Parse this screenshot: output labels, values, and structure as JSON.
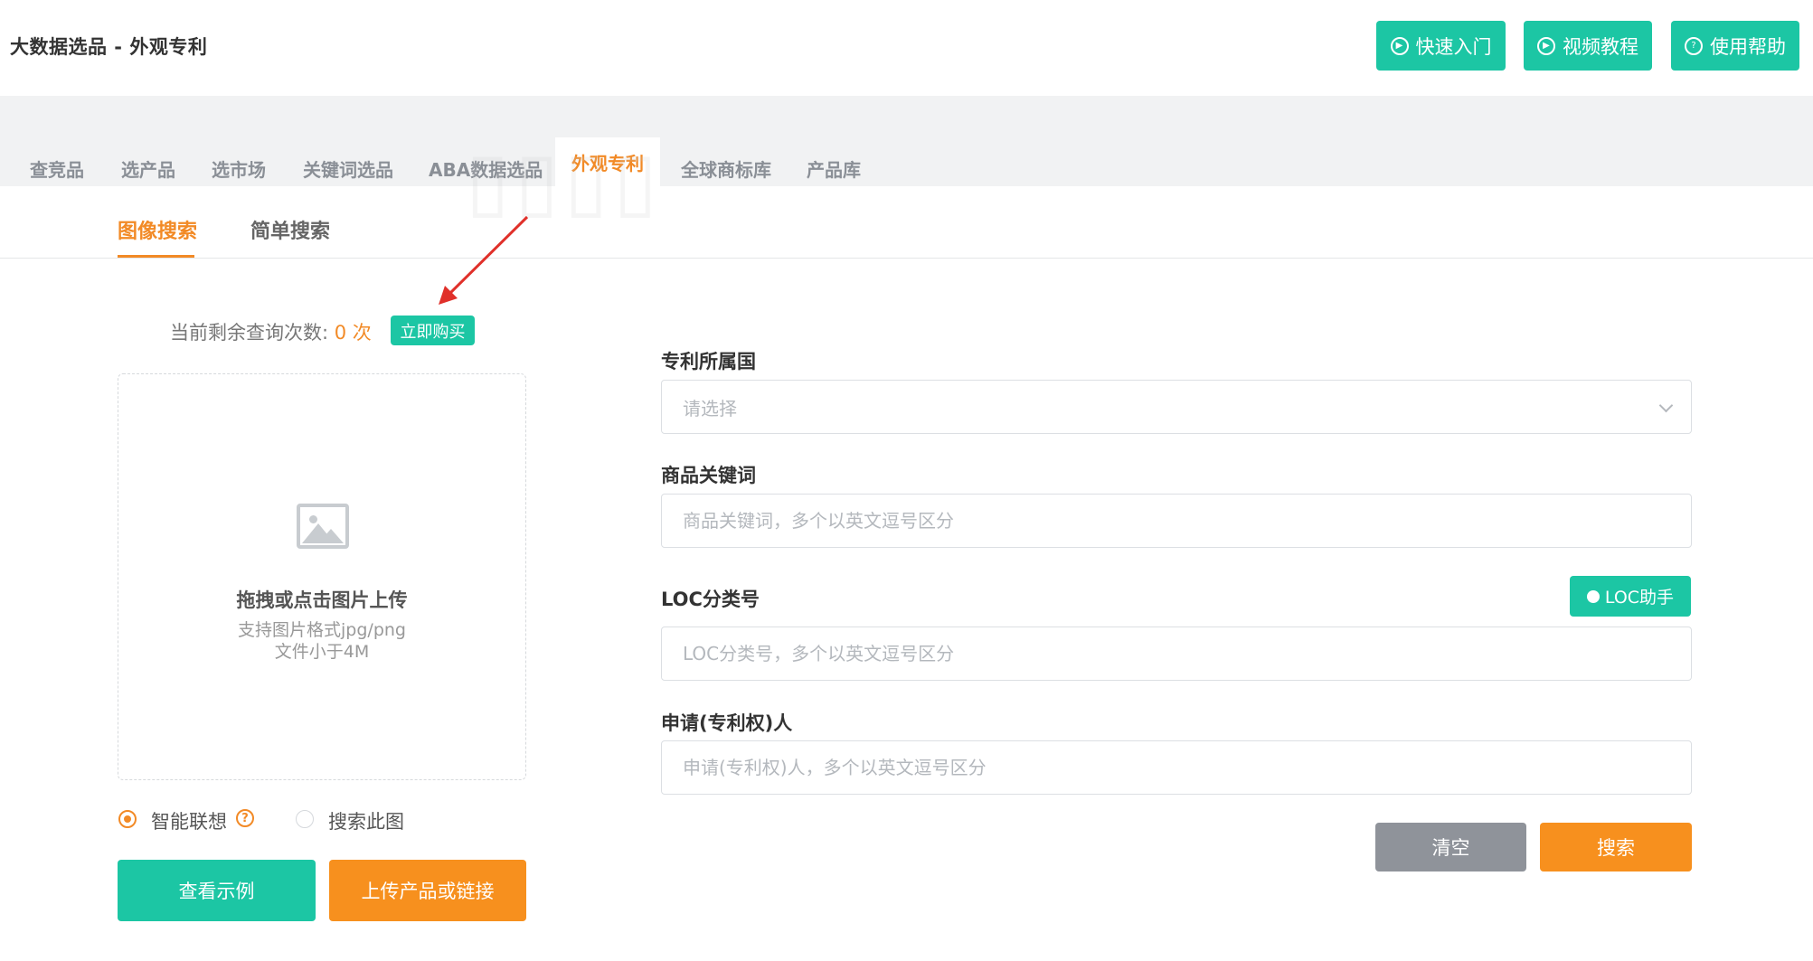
{
  "header": {
    "title": "大数据选品 - 外观专利",
    "buttons": [
      {
        "label": "快速入门",
        "icon": "play-circle-icon"
      },
      {
        "label": "视频教程",
        "icon": "play-circle-icon"
      },
      {
        "label": "使用帮助",
        "icon": "help-circle-icon"
      }
    ]
  },
  "nav": {
    "tabs": [
      {
        "label": "查竞品"
      },
      {
        "label": "选产品"
      },
      {
        "label": "选市场"
      },
      {
        "label": "关键词选品"
      },
      {
        "label": "ABA数据选品"
      },
      {
        "label": "外观专利",
        "active": true
      },
      {
        "label": "全球商标库"
      },
      {
        "label": "产品库"
      }
    ]
  },
  "subtabs": [
    {
      "label": "图像搜索",
      "active": true
    },
    {
      "label": "简单搜索"
    }
  ],
  "quota": {
    "label": "当前剩余查询次数:",
    "count": "0 次",
    "buy_label": "立即购买"
  },
  "upload": {
    "title": "拖拽或点击图片上传",
    "format_hint": "支持图片格式jpg/png",
    "size_hint": "文件小于4M"
  },
  "mode": {
    "option1": "智能联想",
    "option2": "搜索此图",
    "selected": "智能联想"
  },
  "left_buttons": {
    "example": "查看示例",
    "upload_link": "上传产品或链接"
  },
  "form": {
    "country_label": "专利所属国",
    "country_placeholder": "请选择",
    "keyword_label": "商品关键词",
    "keyword_placeholder": "商品关键词，多个以英文逗号区分",
    "loc_label": "LOC分类号",
    "loc_helper": "LOC助手",
    "loc_placeholder": "LOC分类号，多个以英文逗号区分",
    "applicant_label": "申请(专利权)人",
    "applicant_placeholder": "申请(专利权)人，多个以英文逗号区分"
  },
  "actions": {
    "clear": "清空",
    "search": "搜索"
  },
  "colors": {
    "teal": "#1cc6a4",
    "orange": "#f28a26",
    "gray_button": "#8f939a"
  }
}
